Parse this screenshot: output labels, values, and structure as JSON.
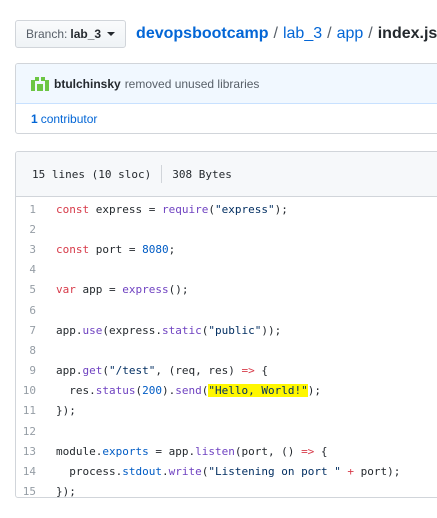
{
  "branch": {
    "label": "Branch:",
    "value": "lab_3"
  },
  "breadcrumb": {
    "repo": "devopsbootcamp",
    "folder1": "lab_3",
    "folder2": "app",
    "file": "index.js",
    "separator": "/"
  },
  "commit": {
    "author": "btulchinsky",
    "message": "removed unused libraries"
  },
  "contributors": {
    "count": "1",
    "label": "contributor"
  },
  "file_info": {
    "lines": "15 lines (10 sloc)",
    "size": "308 Bytes"
  },
  "code": {
    "line_numbers": [
      "1",
      "2",
      "3",
      "4",
      "5",
      "6",
      "7",
      "8",
      "9",
      "10",
      "11",
      "12",
      "13",
      "14",
      "15"
    ],
    "l1": {
      "k": "const",
      "a": " express = ",
      "f": "require",
      "b": "(",
      "s": "\"express\"",
      "c": ");"
    },
    "l3": {
      "k": "const",
      "a": " port = ",
      "n": "8080",
      "c": ";"
    },
    "l5": {
      "k": "var",
      "a": " app = ",
      "f": "express",
      "c": "();"
    },
    "l7": {
      "a": "app.",
      "f": "use",
      "b": "(express.",
      "f2": "static",
      "b2": "(",
      "s": "\"public\"",
      "c": "));"
    },
    "l9": {
      "a": "app.",
      "f": "get",
      "b": "(",
      "s": "\"/test\"",
      "c": ", (req, res) ",
      "k": "=>",
      "d": " {"
    },
    "l10": {
      "a": "  res.",
      "f": "status",
      "b": "(",
      "n": "200",
      "c": ").",
      "f2": "send",
      "d": "(",
      "s": "\"Hello, World!\"",
      "e": ");"
    },
    "l11": {
      "a": "});"
    },
    "l13": {
      "a": "module.",
      "n": "exports",
      "b": " = app.",
      "f": "listen",
      "c": "(port, () ",
      "k": "=>",
      "d": " {"
    },
    "l14": {
      "a": "  process.",
      "n": "stdout",
      "b": ".",
      "f": "write",
      "c": "(",
      "s": "\"Listening on port \"",
      "k": " +",
      "d": " port);"
    },
    "l15": {
      "a": "});"
    }
  }
}
